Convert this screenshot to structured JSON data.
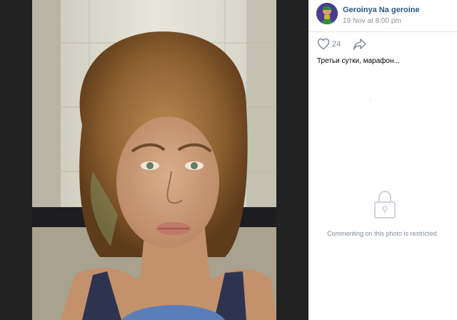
{
  "post": {
    "author_name": "Geroinya Na geroine",
    "date": "19 Nov at 8:00 pm",
    "likes": "24",
    "caption": "Третьи сутки, марафон...",
    "comments_notice": "Commenting on this photo is restricted."
  },
  "icons": {
    "like": "heart-icon",
    "share": "share-arrow-icon",
    "lock": "lock-icon"
  },
  "colors": {
    "background": "#222222",
    "panel": "#ffffff",
    "author_link": "#2a5885",
    "muted_text": "#828a99",
    "date_text": "#939393"
  }
}
